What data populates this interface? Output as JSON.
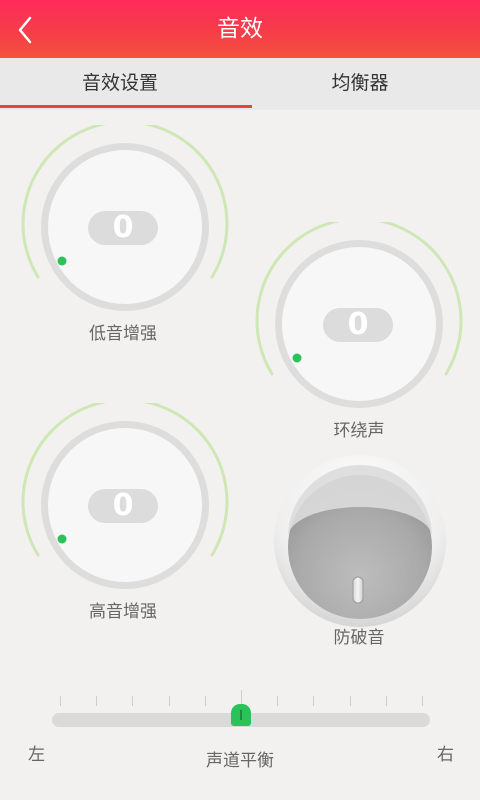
{
  "header": {
    "title": "音效",
    "back_icon": "chevron-left-icon"
  },
  "tabs": [
    {
      "label": "音效设置",
      "active": true
    },
    {
      "label": "均衡器",
      "active": false
    }
  ],
  "knobs": {
    "bass": {
      "value": "0",
      "label": "低音增强"
    },
    "surround": {
      "value": "0",
      "label": "环绕声"
    },
    "treble": {
      "value": "0",
      "label": "高音增强"
    },
    "anti_pop": {
      "label": "防破音"
    }
  },
  "balance": {
    "left": "左",
    "right": "右",
    "label": "声道平衡",
    "position": 0.5
  },
  "colors": {
    "header": "#f53f47",
    "accent": "#e7453c",
    "dot": "#2bc25a",
    "arc": "#cfe7b5"
  }
}
